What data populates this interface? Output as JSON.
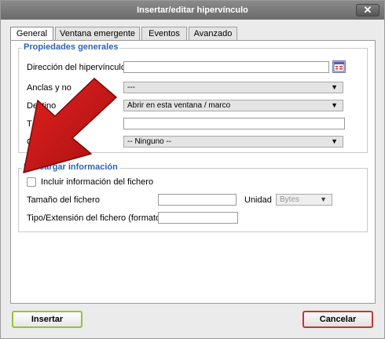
{
  "dialog": {
    "title": "Insertar/editar hipervínculo",
    "close_label": "✕"
  },
  "tabs": [
    {
      "label": "General",
      "active": true
    },
    {
      "label": "Ventana emergente",
      "active": false
    },
    {
      "label": "Eventos",
      "active": false
    },
    {
      "label": "Avanzado",
      "active": false
    }
  ],
  "general": {
    "legend": "Propiedades generales",
    "url_label": "Dirección del hipervínculo",
    "url_value": "",
    "anchors_label": "Anclas y no",
    "anchors_value": "---",
    "target_label": "Destino",
    "target_value": "Abrir en esta ventana / marco",
    "title_label": "T",
    "title_value": "",
    "class_label": "C",
    "class_value": "-- Ninguno --"
  },
  "download": {
    "legend": "Descargar información",
    "include_label": "Incluir información del fichero",
    "include_checked": false,
    "size_label": "Tamaño del fichero",
    "size_value": "",
    "unit_label": "Unidad",
    "unit_value": "Bytes",
    "type_label": "Tipo/Extensión del fichero (formato)",
    "type_value": ""
  },
  "footer": {
    "insert_label": "Insertar",
    "cancel_label": "Cancelar"
  },
  "colors": {
    "accent": "#2d64b3",
    "insert_border": "#9cbf3c",
    "cancel_border": "#c0392b",
    "arrow_red": "#cc1a1a"
  },
  "icons": {
    "url_picker": "link-browser-icon",
    "select_arrow": "triangle-down-icon",
    "overlay": "red-pointer-arrow"
  }
}
